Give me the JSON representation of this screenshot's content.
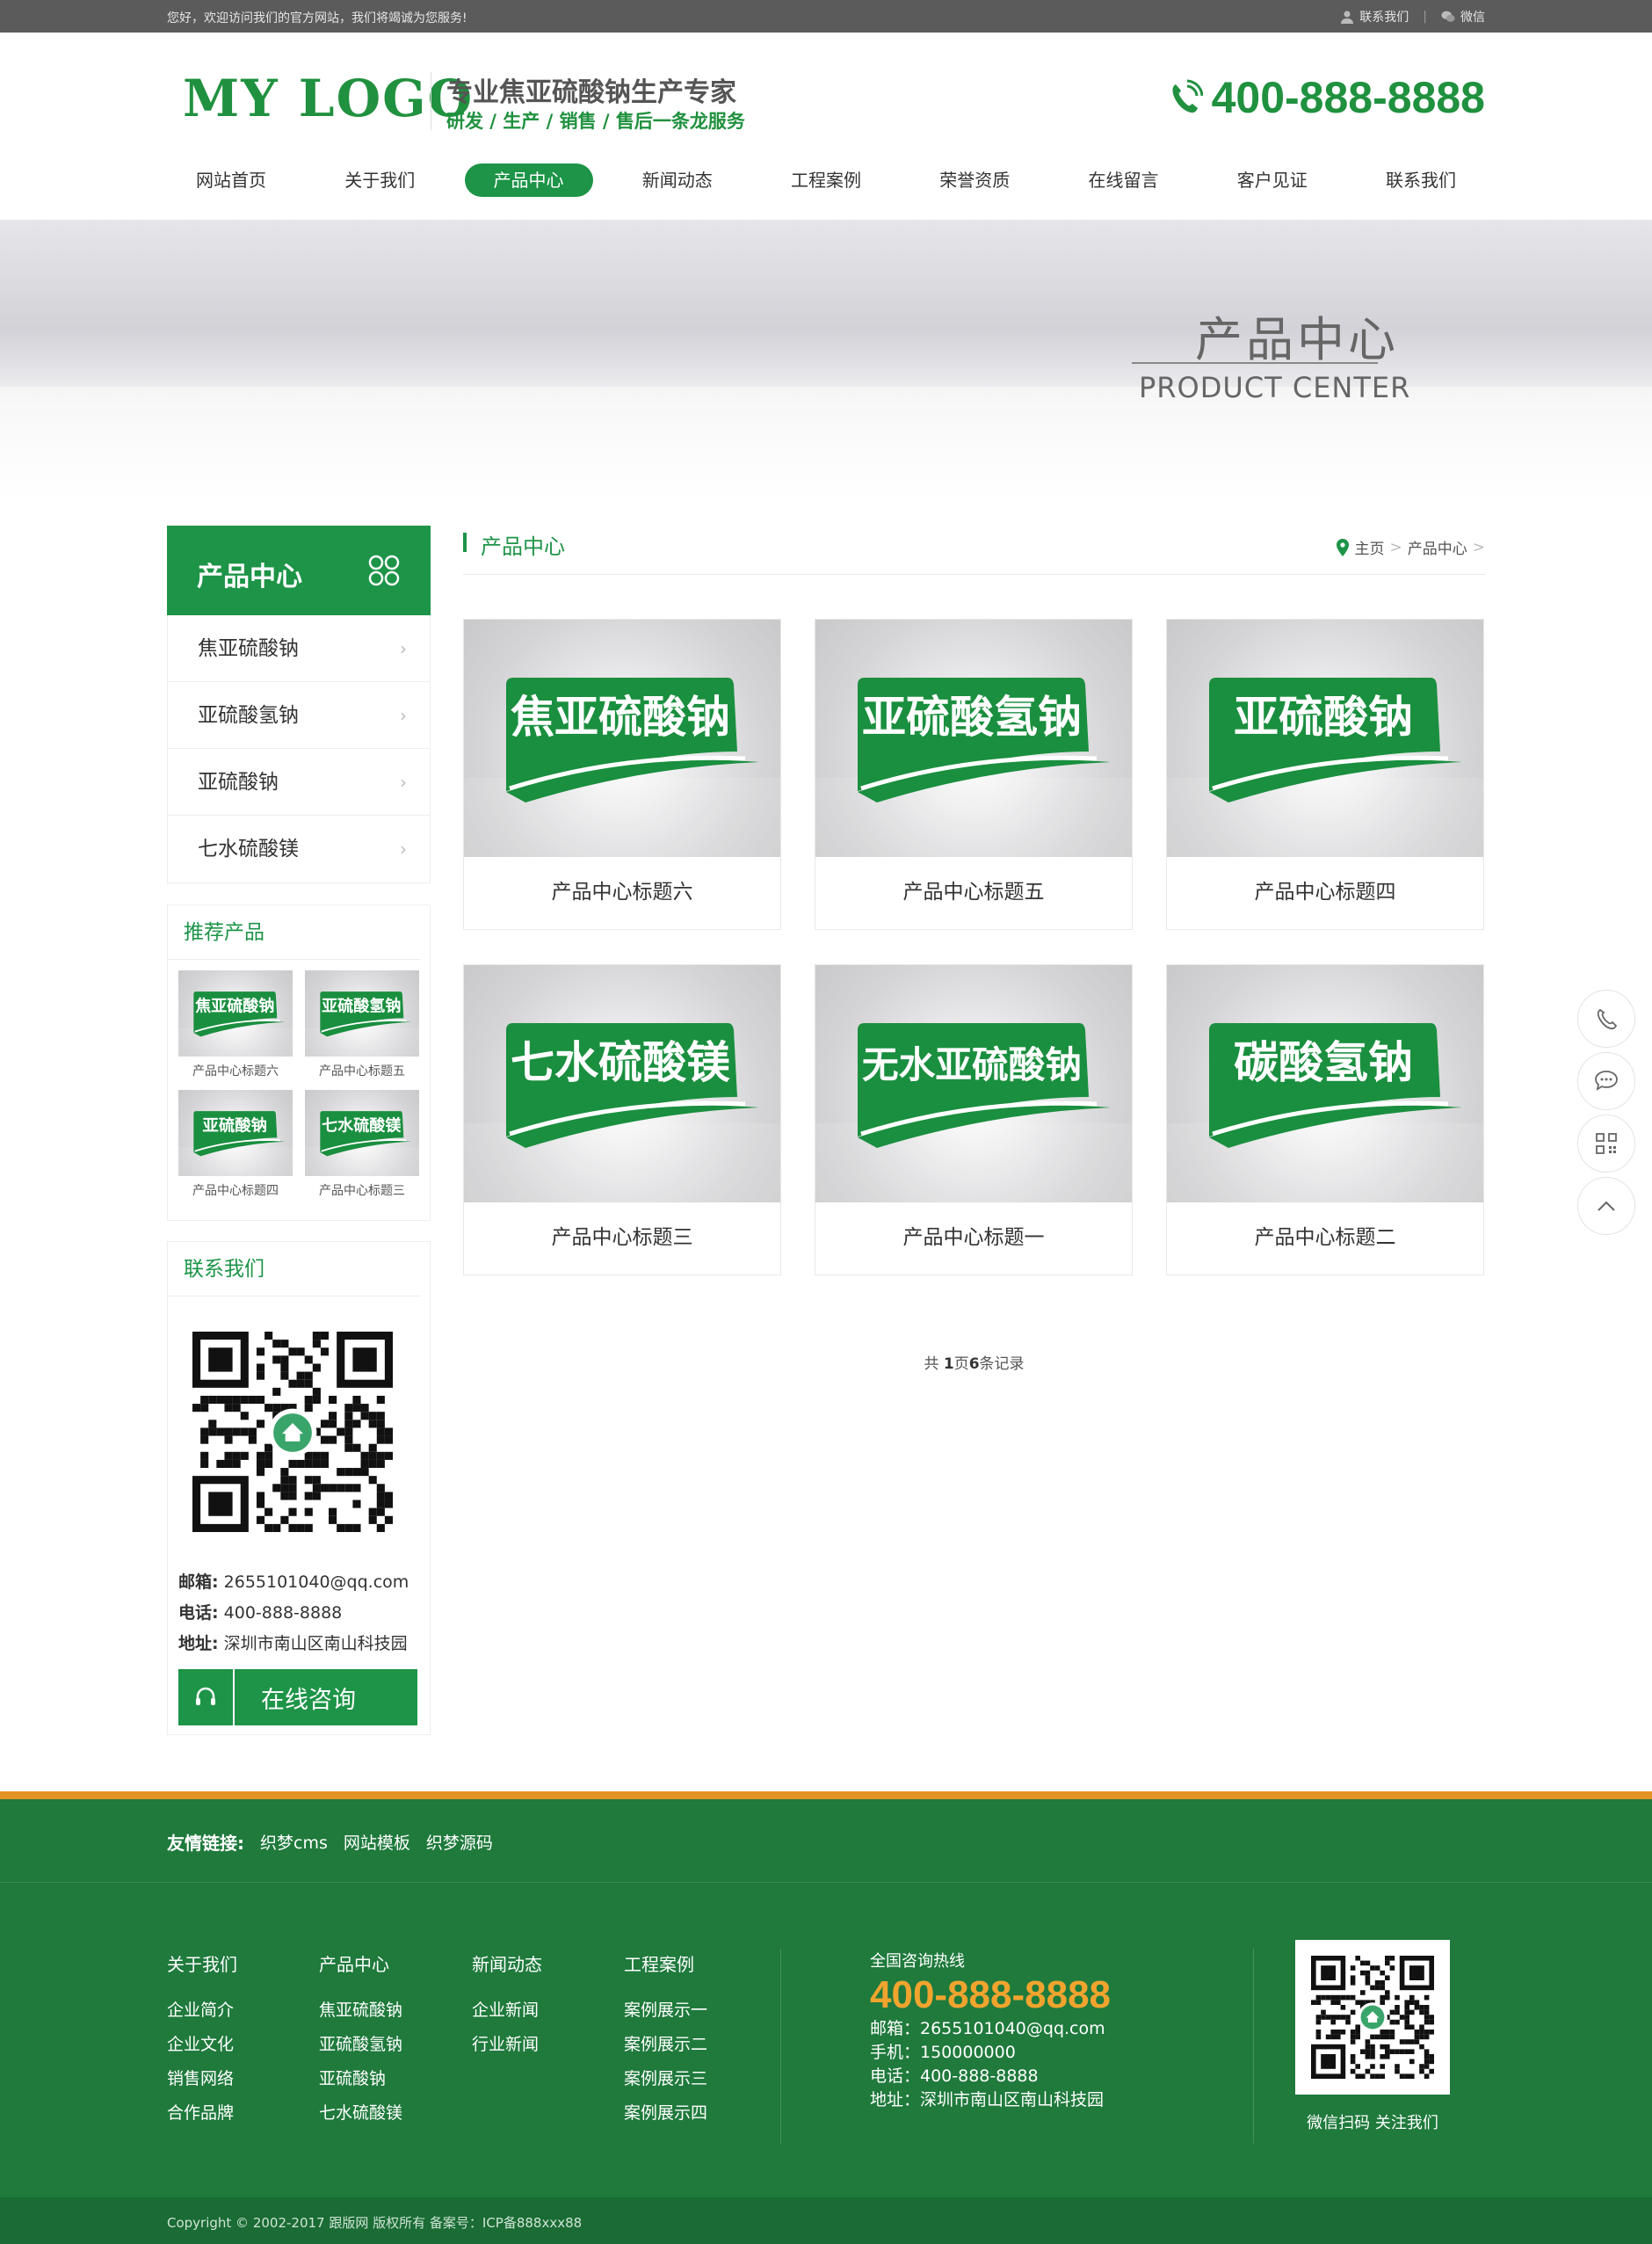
{
  "topbar": {
    "welcome": "您好，欢迎访问我们的官方网站，我们将竭诚为您服务!",
    "contact_link": "联系我们",
    "wechat_link": "微信"
  },
  "header": {
    "logo": "MY LOGO",
    "slogan_main": "专业焦亚硫酸钠生产专家",
    "slogan_sub": "研发 / 生产 / 销售 / 售后一条龙服务",
    "hotline": "400-888-8888"
  },
  "nav": [
    {
      "label": "网站首页"
    },
    {
      "label": "关于我们"
    },
    {
      "label": "产品中心",
      "active": true
    },
    {
      "label": "新闻动态"
    },
    {
      "label": "工程案例"
    },
    {
      "label": "荣誉资质"
    },
    {
      "label": "在线留言"
    },
    {
      "label": "客户见证"
    },
    {
      "label": "联系我们"
    }
  ],
  "banner": {
    "title_cn": "产品中心",
    "title_en": "PRODUCT CENTER"
  },
  "sidebar": {
    "title": "产品中心",
    "menu": [
      "焦亚硫酸钠",
      "亚硫酸氢钠",
      "亚硫酸钠",
      "七水硫酸镁"
    ],
    "recommend_title": "推荐产品",
    "recommend": [
      {
        "label": "焦亚硫酸钠",
        "title": "产品中心标题六"
      },
      {
        "label": "亚硫酸氢钠",
        "title": "产品中心标题五"
      },
      {
        "label": "亚硫酸钠",
        "title": "产品中心标题四"
      },
      {
        "label": "七水硫酸镁",
        "title": "产品中心标题三"
      }
    ],
    "contact_title": "联系我们",
    "contact": [
      {
        "key": "邮箱:",
        "value": "2655101040@qq.com"
      },
      {
        "key": "电话:",
        "value": "400-888-8888"
      },
      {
        "key": "地址:",
        "value": "深圳市南山区南山科技园"
      }
    ],
    "consult_label": "在线咨询"
  },
  "main": {
    "title": "产品中心",
    "breadcrumb": [
      "主页",
      "产品中心"
    ],
    "products": [
      {
        "label": "焦亚硫酸钠",
        "title": "产品中心标题六"
      },
      {
        "label": "亚硫酸氢钠",
        "title": "产品中心标题五"
      },
      {
        "label": "亚硫酸钠",
        "title": "产品中心标题四"
      },
      {
        "label": "七水硫酸镁",
        "title": "产品中心标题三"
      },
      {
        "label": "无水亚硫酸钠",
        "title": "产品中心标题一"
      },
      {
        "label": "碳酸氢钠",
        "title": "产品中心标题二"
      }
    ],
    "pager": {
      "prefix": "共 ",
      "pages": "1",
      "mid": "页",
      "records": "6",
      "suffix": "条记录"
    }
  },
  "float_tools": [
    "phone-icon",
    "chat-icon",
    "qrcode-icon",
    "back-to-top-icon"
  ],
  "footer": {
    "links_label": "友情链接:",
    "links": [
      "织梦cms",
      "网站模板",
      "织梦源码"
    ],
    "columns": [
      {
        "heading": "关于我们",
        "items": [
          "企业简介",
          "企业文化",
          "销售网络",
          "合作品牌"
        ]
      },
      {
        "heading": "产品中心",
        "items": [
          "焦亚硫酸钠",
          "亚硫酸氢钠",
          "亚硫酸钠",
          "七水硫酸镁"
        ]
      },
      {
        "heading": "新闻动态",
        "items": [
          "企业新闻",
          "行业新闻"
        ]
      },
      {
        "heading": "工程案例",
        "items": [
          "案例展示一",
          "案例展示二",
          "案例展示三",
          "案例展示四"
        ]
      }
    ],
    "hotline_caption": "全国咨询热线",
    "hotline": "400-888-8888",
    "contact_lines": [
      "邮箱：2655101040@qq.com",
      "手机：150000000",
      "电话：400-888-8888",
      "地址：深圳市南山区南山科技园"
    ],
    "qr_caption": "微信扫码 关注我们",
    "copyright": "Copyright © 2002-2017 跟版网 版权所有    备案号：ICP备888xxx88"
  },
  "colors": {
    "brand_green": "#1d9447",
    "footer_green": "#1f7a3c",
    "accent_orange": "#e29324",
    "hotline_orange": "#f0a42e"
  }
}
